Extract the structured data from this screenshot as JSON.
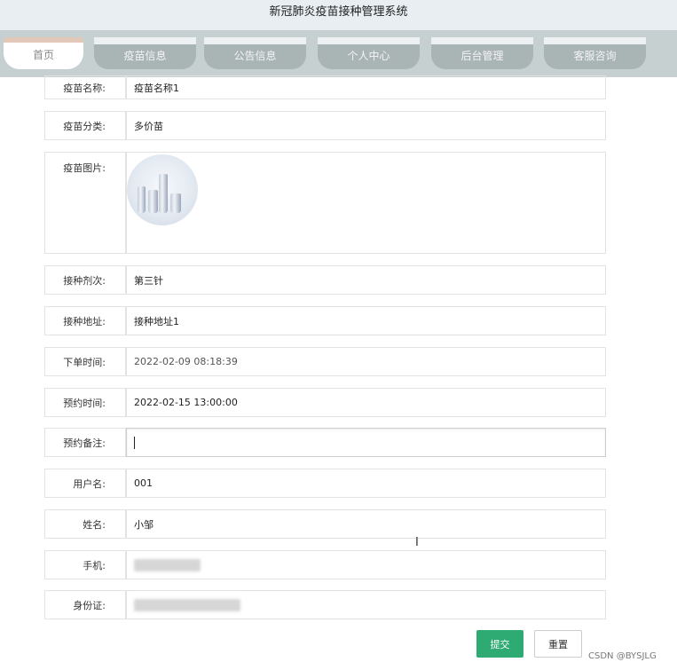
{
  "app": {
    "title": "新冠肺炎疫苗接种管理系统"
  },
  "nav": {
    "tabs": [
      {
        "label": "首页"
      },
      {
        "label": "疫苗信息"
      },
      {
        "label": "公告信息"
      },
      {
        "label": "个人中心"
      },
      {
        "label": "后台管理"
      },
      {
        "label": "客服咨询"
      }
    ]
  },
  "form": {
    "vaccine_name": {
      "label": "疫苗名称:",
      "value": "疫苗名称1"
    },
    "vaccine_type": {
      "label": "疫苗分类:",
      "value": "多价苗"
    },
    "vaccine_image": {
      "label": "疫苗图片:"
    },
    "dose": {
      "label": "接种剂次:",
      "value": "第三针"
    },
    "address": {
      "label": "接种地址:",
      "value": "接种地址1"
    },
    "order_time": {
      "label": "下单时间:",
      "value": "2022-02-09 08:18:39"
    },
    "appointment_time": {
      "label": "预约时间:",
      "value": "2022-02-15 13:00:00"
    },
    "remark": {
      "label": "预约备注:",
      "value": ""
    },
    "username": {
      "label": "用户名:",
      "value": "001"
    },
    "name": {
      "label": "姓名:",
      "value": "小邹"
    },
    "phone": {
      "label": "手机:"
    },
    "id_card": {
      "label": "身份证:"
    }
  },
  "buttons": {
    "submit": "提交",
    "reset": "重置"
  },
  "watermark": "CSDN @BYSJLG"
}
